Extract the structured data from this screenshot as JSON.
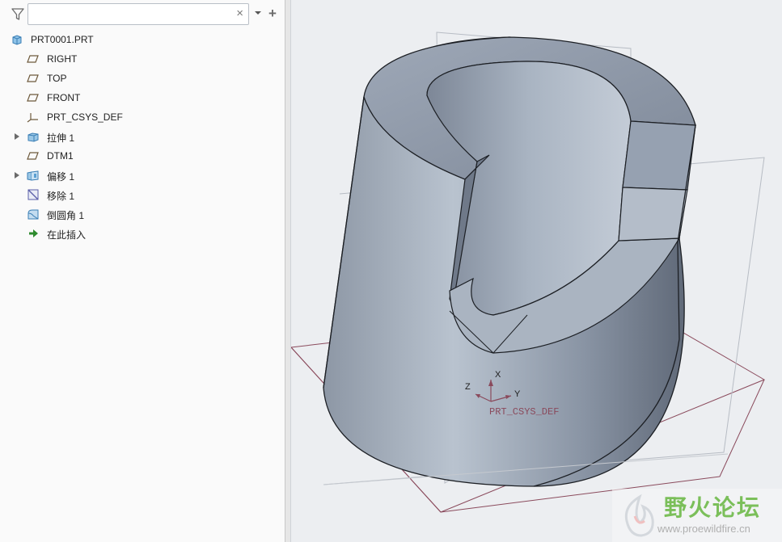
{
  "search": {
    "value": "",
    "placeholder": "",
    "clear_glyph": "×"
  },
  "toolbar": {
    "filter_icon": "filter-icon",
    "dropdown_icon": "chevron-down-icon",
    "add_glyph": "+"
  },
  "tree": {
    "root": {
      "label": "PRT0001.PRT",
      "icon": "part-icon"
    },
    "items": [
      {
        "label": "RIGHT",
        "icon": "datum-plane-icon",
        "expandable": false
      },
      {
        "label": "TOP",
        "icon": "datum-plane-icon",
        "expandable": false
      },
      {
        "label": "FRONT",
        "icon": "datum-plane-icon",
        "expandable": false
      },
      {
        "label": "PRT_CSYS_DEF",
        "icon": "coordinate-system-icon",
        "expandable": false
      },
      {
        "label": "拉伸 1",
        "icon": "extrude-icon",
        "expandable": true
      },
      {
        "label": "DTM1",
        "icon": "datum-plane-icon",
        "expandable": false
      },
      {
        "label": "偏移 1",
        "icon": "offset-icon",
        "expandable": true
      },
      {
        "label": "移除 1",
        "icon": "remove-icon",
        "expandable": false
      },
      {
        "label": "倒圆角 1",
        "icon": "round-icon",
        "expandable": false
      },
      {
        "label": "在此插入",
        "icon": "insert-here-arrow-icon",
        "expandable": false
      }
    ]
  },
  "viewport": {
    "csys": {
      "label": "PRT_CSYS_DEF",
      "x_axis": "X",
      "y_axis": "Y",
      "z_axis": "Z"
    },
    "datum_color": "#8a4a5c",
    "model_color": "#a3aebe"
  },
  "watermark": {
    "title": "野火论坛",
    "url": "www.proewildfire.cn"
  }
}
